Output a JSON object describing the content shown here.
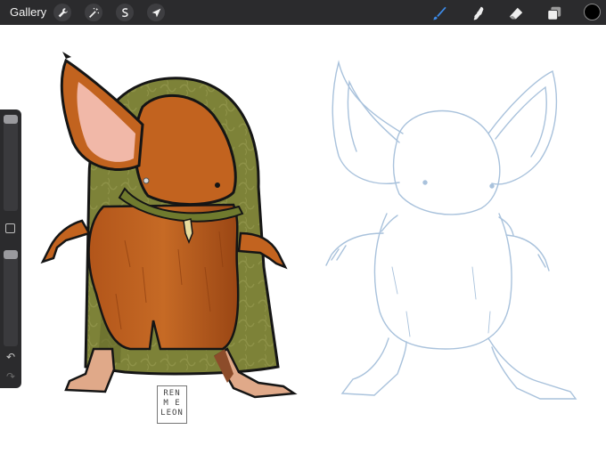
{
  "topbar": {
    "gallery_label": "Gallery",
    "left_tools": [
      {
        "icon": "wrench-icon"
      },
      {
        "icon": "magic-wand-icon"
      },
      {
        "icon": "selection-icon"
      },
      {
        "icon": "transform-arrow-icon"
      }
    ],
    "right_tools": [
      {
        "icon": "brush-icon",
        "active": true
      },
      {
        "icon": "smudge-icon"
      },
      {
        "icon": "eraser-icon"
      },
      {
        "icon": "layers-icon"
      }
    ],
    "active_color": "#000000",
    "accent_color": "#3d8ae6"
  },
  "sidebar": {
    "brush_size_level": 0.0,
    "opacity_level": 0.0,
    "undo_icon": "undo-icon",
    "redo_icon": "redo-icon"
  },
  "artwork": {
    "signature_lines": [
      "REN",
      "M E",
      "LEON"
    ],
    "colors": {
      "fur": "#c2631f",
      "fur_dark": "#8e3f10",
      "cloak": "#7d8238",
      "cloak_pattern": "#8e9248",
      "ear_inner": "#f1b8a8",
      "outline": "#151515",
      "sketch": "#a9c2dc"
    }
  }
}
